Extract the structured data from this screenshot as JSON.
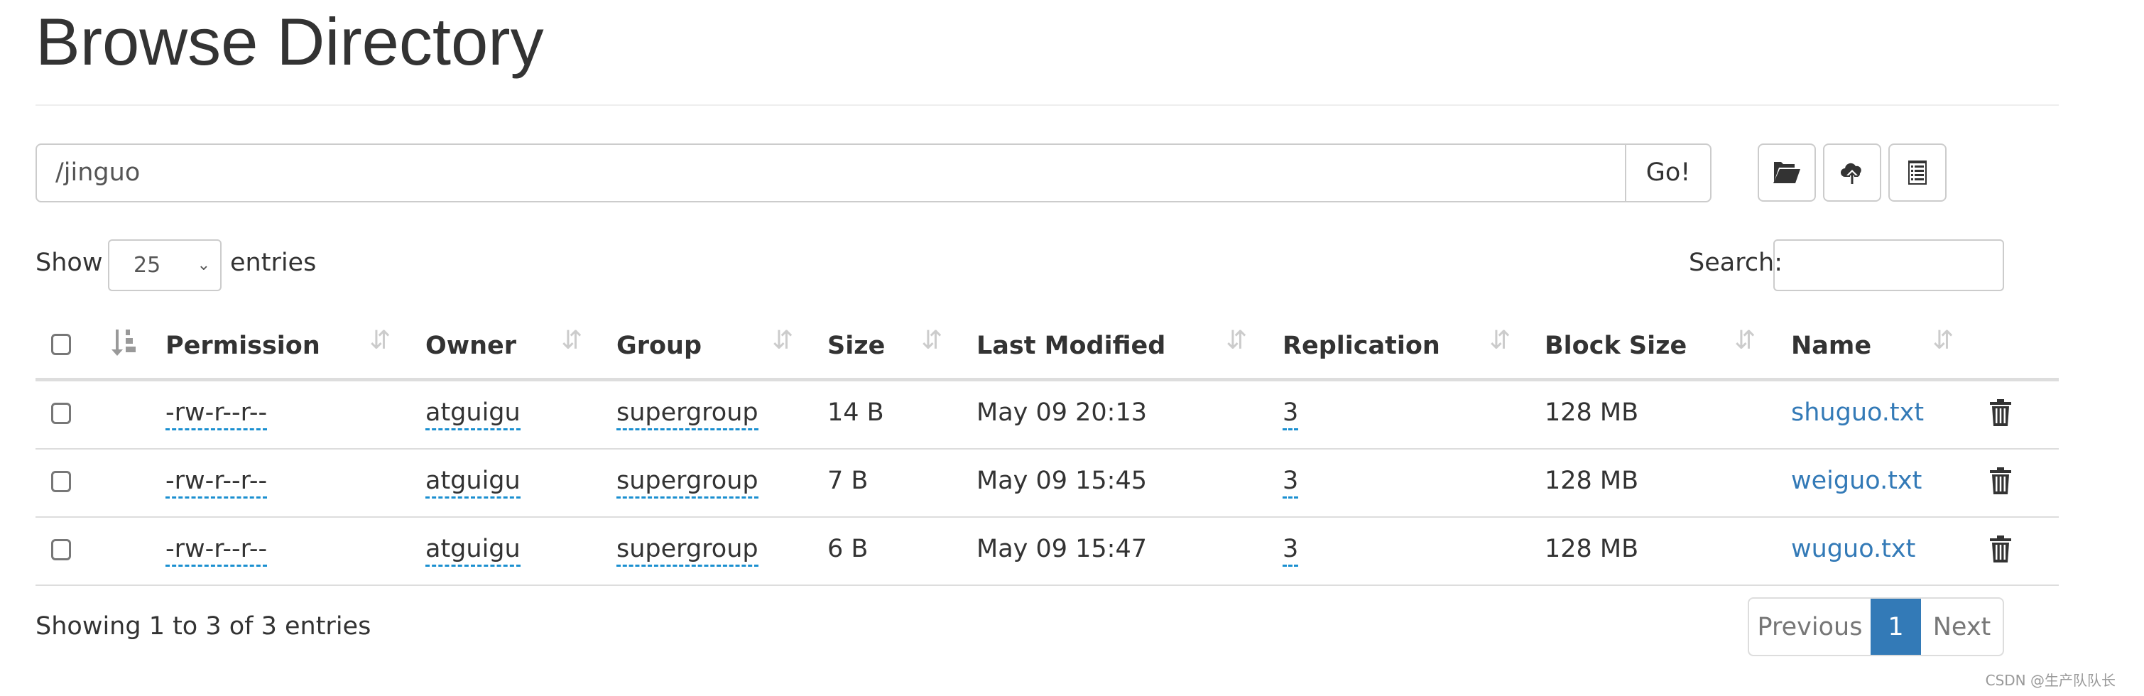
{
  "title": "Browse Directory",
  "path": {
    "value": "/jinguo",
    "go_label": "Go!"
  },
  "toolbar": {
    "icons": [
      "folder-open-icon",
      "cloud-upload-icon",
      "list-alt-icon"
    ]
  },
  "length": {
    "show": "Show",
    "value": "25",
    "entries": "entries"
  },
  "search": {
    "label": "Search:",
    "value": ""
  },
  "columns": [
    "Permission",
    "Owner",
    "Group",
    "Size",
    "Last Modified",
    "Replication",
    "Block Size",
    "Name"
  ],
  "rows": [
    {
      "permission": "-rw-r--r--",
      "owner": "atguigu",
      "group": "supergroup",
      "size": "14 B",
      "modified": "May 09 20:13",
      "replication": "3",
      "block_size": "128 MB",
      "name": "shuguo.txt"
    },
    {
      "permission": "-rw-r--r--",
      "owner": "atguigu",
      "group": "supergroup",
      "size": "7 B",
      "modified": "May 09 15:45",
      "replication": "3",
      "block_size": "128 MB",
      "name": "weiguo.txt"
    },
    {
      "permission": "-rw-r--r--",
      "owner": "atguigu",
      "group": "supergroup",
      "size": "6 B",
      "modified": "May 09 15:47",
      "replication": "3",
      "block_size": "128 MB",
      "name": "wuguo.txt"
    }
  ],
  "info": "Showing 1 to 3 of 3 entries",
  "pagination": {
    "previous": "Previous",
    "current": "1",
    "next": "Next",
    "active_color": "#337ab7"
  },
  "watermark": "CSDN @生产队队长"
}
